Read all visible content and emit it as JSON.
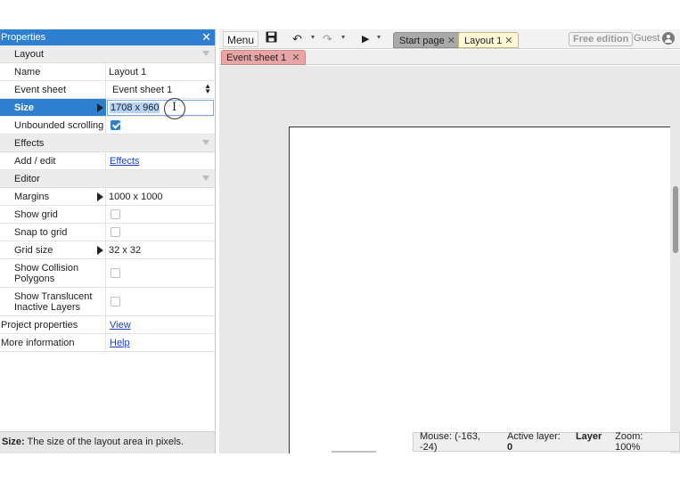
{
  "properties_panel": {
    "title": "Properties",
    "close_glyph": "✕",
    "sections": {
      "layout": "Layout",
      "effects": "Effects",
      "editor": "Editor"
    },
    "rows": {
      "name_label": "Name",
      "name_value": "Layout 1",
      "event_sheet_label": "Event sheet",
      "event_sheet_value": "Event sheet 1",
      "size_label": "Size",
      "size_value": "1708 x 960",
      "unbounded_label": "Unbounded scrolling",
      "unbounded_checked": true,
      "add_edit_label": "Add / edit",
      "add_edit_link": "Effects",
      "margins_label": "Margins",
      "margins_value": "1000 x 1000",
      "show_grid_label": "Show grid",
      "snap_grid_label": "Snap to grid",
      "grid_size_label": "Grid size",
      "grid_size_value": "32 x 32",
      "collision_label_1": "Show Collision",
      "collision_label_2": "Polygons",
      "translucent_label_1": "Show Translucent",
      "translucent_label_2": "Inactive Layers",
      "project_props_label": "Project properties",
      "project_props_link": "View",
      "more_info_label": "More information",
      "more_info_link": "Help"
    },
    "status": {
      "key": "Size:",
      "text": "The size of the layout area in pixels."
    }
  },
  "toolbar": {
    "menu_label": "Menu",
    "tabs": [
      {
        "label": "Start page",
        "close": "✕"
      },
      {
        "label": "Layout 1",
        "close": "✕"
      }
    ],
    "free_edition": "Free edition",
    "guest": "Guest"
  },
  "subtabs": {
    "event_sheet": "Event sheet 1",
    "close": "✕"
  },
  "status_bar": {
    "mouse": "Mouse: (-163, -24)",
    "active_layer_label": "Active layer:",
    "active_layer_value": "Layer 0",
    "zoom": "Zoom: 100%"
  },
  "colors": {
    "accent": "#2f7fd0",
    "event_tab": "#e9a5a5",
    "layout_tab": "#fff7d6"
  }
}
